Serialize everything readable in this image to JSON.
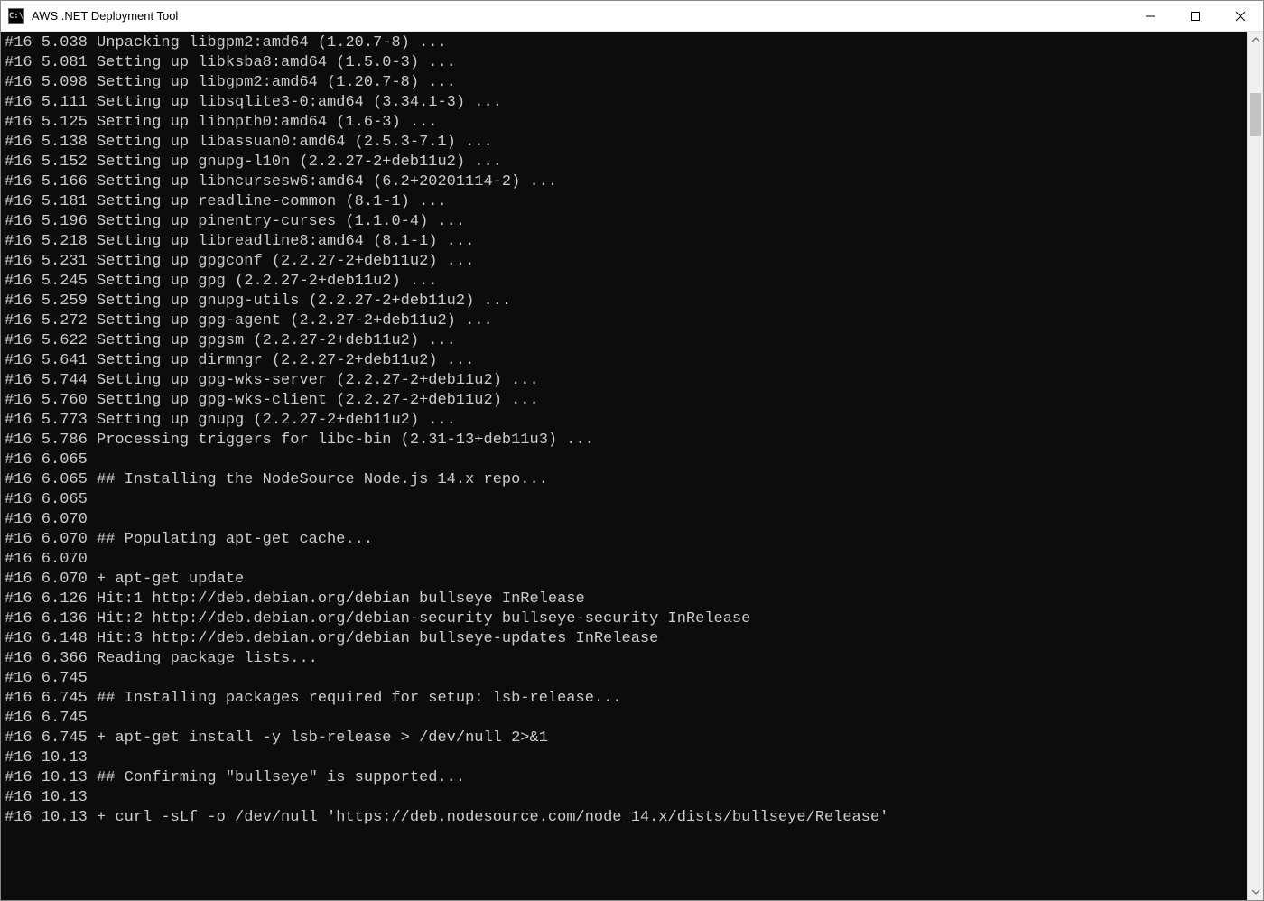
{
  "window": {
    "title": "AWS .NET Deployment Tool",
    "icon_label": "C:\\"
  },
  "terminal": {
    "lines": [
      "#16 5.038 Unpacking libgpm2:amd64 (1.20.7-8) ...",
      "#16 5.081 Setting up libksba8:amd64 (1.5.0-3) ...",
      "#16 5.098 Setting up libgpm2:amd64 (1.20.7-8) ...",
      "#16 5.111 Setting up libsqlite3-0:amd64 (3.34.1-3) ...",
      "#16 5.125 Setting up libnpth0:amd64 (1.6-3) ...",
      "#16 5.138 Setting up libassuan0:amd64 (2.5.3-7.1) ...",
      "#16 5.152 Setting up gnupg-l10n (2.2.27-2+deb11u2) ...",
      "#16 5.166 Setting up libncursesw6:amd64 (6.2+20201114-2) ...",
      "#16 5.181 Setting up readline-common (8.1-1) ...",
      "#16 5.196 Setting up pinentry-curses (1.1.0-4) ...",
      "#16 5.218 Setting up libreadline8:amd64 (8.1-1) ...",
      "#16 5.231 Setting up gpgconf (2.2.27-2+deb11u2) ...",
      "#16 5.245 Setting up gpg (2.2.27-2+deb11u2) ...",
      "#16 5.259 Setting up gnupg-utils (2.2.27-2+deb11u2) ...",
      "#16 5.272 Setting up gpg-agent (2.2.27-2+deb11u2) ...",
      "#16 5.622 Setting up gpgsm (2.2.27-2+deb11u2) ...",
      "#16 5.641 Setting up dirmngr (2.2.27-2+deb11u2) ...",
      "#16 5.744 Setting up gpg-wks-server (2.2.27-2+deb11u2) ...",
      "#16 5.760 Setting up gpg-wks-client (2.2.27-2+deb11u2) ...",
      "#16 5.773 Setting up gnupg (2.2.27-2+deb11u2) ...",
      "#16 5.786 Processing triggers for libc-bin (2.31-13+deb11u3) ...",
      "#16 6.065",
      "#16 6.065 ## Installing the NodeSource Node.js 14.x repo...",
      "#16 6.065",
      "#16 6.070",
      "#16 6.070 ## Populating apt-get cache...",
      "#16 6.070",
      "#16 6.070 + apt-get update",
      "#16 6.126 Hit:1 http://deb.debian.org/debian bullseye InRelease",
      "#16 6.136 Hit:2 http://deb.debian.org/debian-security bullseye-security InRelease",
      "#16 6.148 Hit:3 http://deb.debian.org/debian bullseye-updates InRelease",
      "#16 6.366 Reading package lists...",
      "#16 6.745",
      "#16 6.745 ## Installing packages required for setup: lsb-release...",
      "#16 6.745",
      "#16 6.745 + apt-get install -y lsb-release > /dev/null 2>&1",
      "#16 10.13",
      "#16 10.13 ## Confirming \"bullseye\" is supported...",
      "#16 10.13",
      "#16 10.13 + curl -sLf -o /dev/null 'https://deb.nodesource.com/node_14.x/dists/bullseye/Release'"
    ]
  }
}
